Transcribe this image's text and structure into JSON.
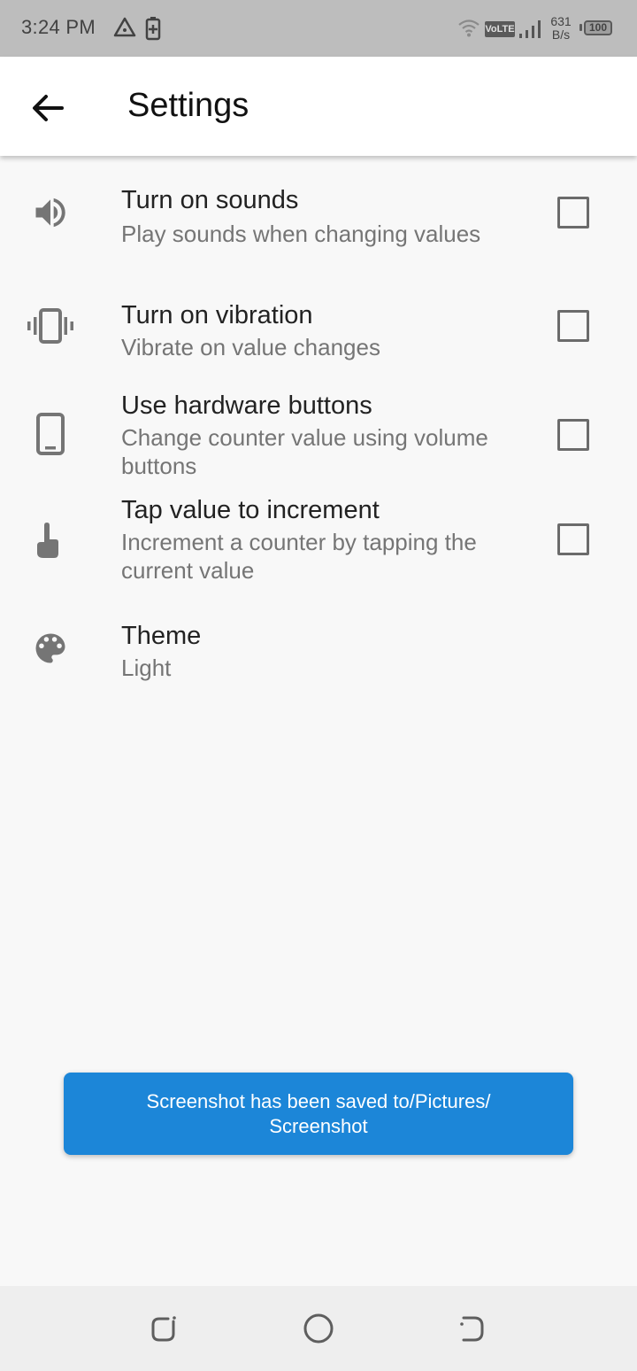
{
  "status_bar": {
    "time": "3:24 PM",
    "network_label": "VoLTE",
    "speed_value": "631",
    "speed_unit": "B/s",
    "battery": "100",
    "icons": [
      "alert-triangle-icon",
      "battery-saver-icon",
      "wifi-icon",
      "signal-icon"
    ]
  },
  "app_bar": {
    "title": "Settings",
    "back_icon": "arrow-left-icon"
  },
  "settings": [
    {
      "icon": "volume-icon",
      "title": "Turn on sounds",
      "subtitle": "Play sounds when changing values",
      "checked": false
    },
    {
      "icon": "vibration-icon",
      "title": "Turn on vibration",
      "subtitle": "Vibrate on value changes",
      "checked": false
    },
    {
      "icon": "phone-icon",
      "title": "Use hardware buttons",
      "subtitle": "Change counter value using volume buttons",
      "checked": false
    },
    {
      "icon": "tap-finger-icon",
      "title": "Tap value to increment",
      "subtitle": "Increment a counter by tapping the current value",
      "checked": false
    },
    {
      "icon": "palette-icon",
      "title": "Theme",
      "subtitle": "Light"
    }
  ],
  "toast": {
    "message": "Screenshot has been saved to/Pictures/ Screenshot"
  },
  "colors": {
    "status_bar": "#bdbdbd",
    "app_bar": "#ffffff",
    "background": "#f8f8f8",
    "toast": "#1c86d8",
    "icon": "#757575"
  },
  "nav_bar": {
    "buttons": [
      "recents-icon",
      "home-icon",
      "back-nav-icon"
    ]
  }
}
